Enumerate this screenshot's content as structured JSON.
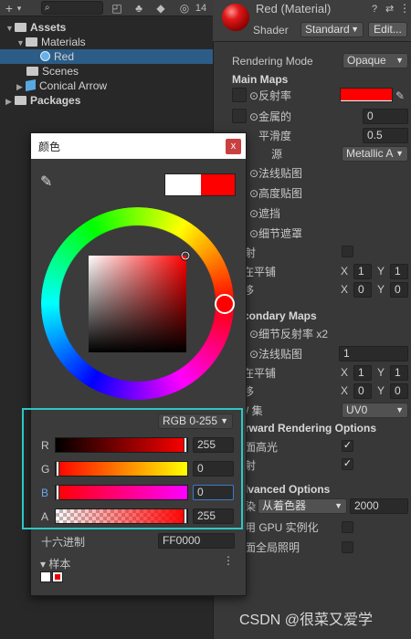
{
  "project": {
    "toolbar": {
      "add": "+",
      "add_caret": "▾",
      "hidden_count": "14"
    },
    "tree": [
      {
        "label": "Assets",
        "bold": true
      },
      {
        "label": "Materials",
        "bold": false
      },
      {
        "label": "Red",
        "bold": false
      },
      {
        "label": "Scenes",
        "bold": false
      },
      {
        "label": "Conical Arrow",
        "bold": false
      },
      {
        "label": "Packages",
        "bold": true
      }
    ]
  },
  "inspector": {
    "title": "Red (Material)",
    "shader_label": "Shader",
    "shader_value": "Standard",
    "edit_button": "Edit...",
    "rendering_mode_label": "Rendering Mode",
    "rendering_mode_value": "Opaque",
    "main_maps": "Main Maps",
    "albedo": "⊙反射率",
    "metallic": "⊙金属的",
    "metallic_value": "0",
    "smoothness": "平滑度",
    "smoothness_value": "0.5",
    "source": "源",
    "source_value": "Metallic A",
    "normal": "⊙法线贴图",
    "height": "⊙高度贴图",
    "occlusion": "⊙遮挡",
    "detail_mask": "⊙细节遮罩",
    "emission": "射",
    "tiling": "在平铺",
    "offset": "移",
    "x_label": "X",
    "y_label": "Y",
    "tiling_x": "1",
    "tiling_y": "1",
    "offset_x": "0",
    "offset_y": "0",
    "secondary_maps": "condary Maps",
    "detail_albedo": "⊙细节反射率 x2",
    "sec_normal": "⊙法线贴图",
    "sec_normal_value": "1",
    "sec_tiling": "在平铺",
    "sec_offset": "移",
    "sec_tiling_x": "1",
    "sec_tiling_y": "1",
    "sec_offset_x": "0",
    "sec_offset_y": "0",
    "uv_set": "/ 集",
    "uv_value": "UV0",
    "forward_options": "rward Rendering Options",
    "specular": "面高光",
    "reflections": "射",
    "advanced_options": "lvanced Options",
    "render_queue": "染",
    "render_queue_mode": "从着色器",
    "render_queue_value": "2000",
    "gpu_instancing": "用 GPU 实例化",
    "double_gi": "面全局照明",
    "albedo_color": "#ff0000"
  },
  "picker": {
    "title": "颜色",
    "close": "x",
    "mode": "RGB 0-255",
    "r_label": "R",
    "r_value": "255",
    "g_label": "G",
    "g_value": "0",
    "b_label": "B",
    "b_value": "0",
    "a_label": "A",
    "a_value": "255",
    "hex_label": "十六进制",
    "hex_value": "FF0000",
    "swatches_label": "样本",
    "more": "⋮",
    "new_color": "#ff0000",
    "old_color": "#ffffff"
  },
  "watermark": "CSDN @很菜又爱学"
}
